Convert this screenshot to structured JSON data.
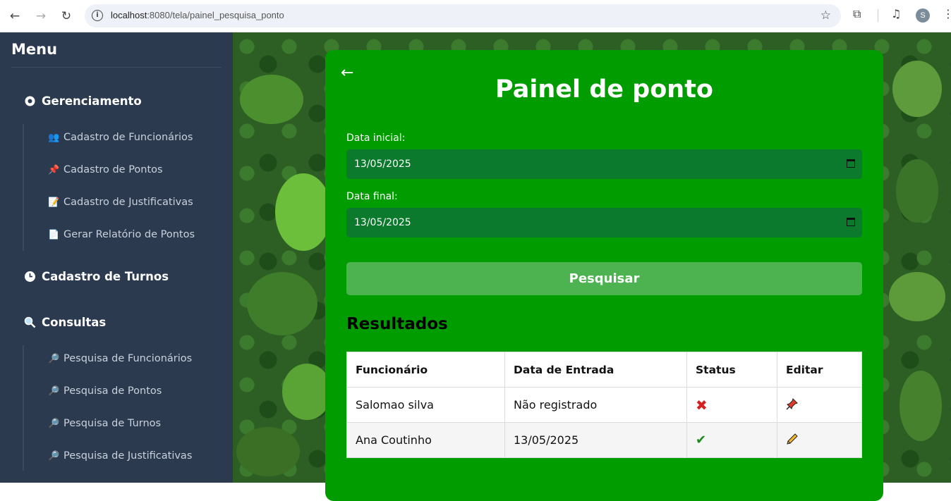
{
  "browser": {
    "url_host": "localhost",
    "url_path": ":8080/tela/painel_pesquisa_ponto",
    "avatar_letter": "S"
  },
  "sidebar": {
    "title": "Menu",
    "sections": [
      {
        "label": "Gerenciamento",
        "icon": "gear-icon",
        "items": [
          {
            "label": "Cadastro de Funcionários",
            "icon": "people-icon"
          },
          {
            "label": "Cadastro de Pontos",
            "icon": "pushpin-icon"
          },
          {
            "label": "Cadastro de Justificativas",
            "icon": "memo-icon"
          },
          {
            "label": "Gerar Relatório de Pontos",
            "icon": "document-icon"
          }
        ]
      },
      {
        "label": "Cadastro de Turnos",
        "icon": "clock-icon",
        "items": []
      },
      {
        "label": "Consultas",
        "icon": "magnifier-icon",
        "items": [
          {
            "label": "Pesquisa de Funcionários",
            "icon": "magnifier-icon"
          },
          {
            "label": "Pesquisa de Pontos",
            "icon": "magnifier-icon"
          },
          {
            "label": "Pesquisa de Turnos",
            "icon": "magnifier-icon"
          },
          {
            "label": "Pesquisa de Justificativas",
            "icon": "magnifier-icon"
          }
        ]
      }
    ]
  },
  "panel": {
    "back_icon": "←",
    "title": "Painel de ponto",
    "start_label": "Data inicial:",
    "start_value": "13/05/2025",
    "end_label": "Data final:",
    "end_value": "13/05/2025",
    "search_button": "Pesquisar",
    "results_title": "Resultados",
    "columns": [
      "Funcionário",
      "Data de Entrada",
      "Status",
      "Editar"
    ],
    "rows": [
      {
        "funcionario": "Salomao silva",
        "data_entrada": "Não registrado",
        "status": "cross-mark-icon",
        "editar": "pushpin-icon"
      },
      {
        "funcionario": "Ana Coutinho",
        "data_entrada": "13/05/2025",
        "status": "check-mark-icon",
        "editar": "pencil-icon"
      }
    ]
  },
  "colors": {
    "sidebar_bg": "#2b3a4f",
    "card_bg": "#009c00",
    "input_bg": "#0b7a2c",
    "button_bg": "#4db350"
  }
}
